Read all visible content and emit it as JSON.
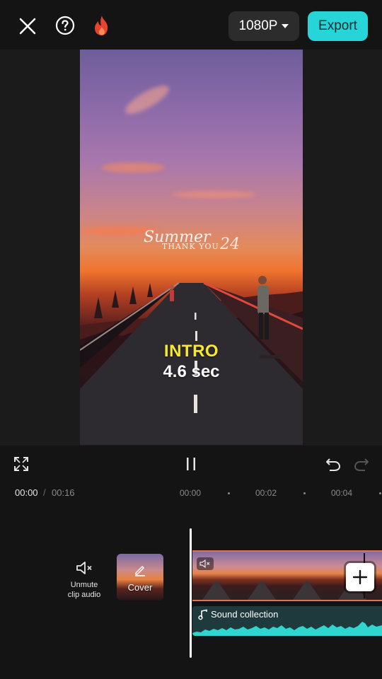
{
  "topbar": {
    "close_icon": "close-icon",
    "help_icon": "help-icon",
    "fire_icon": "fire-icon",
    "resolution_label": "1080P",
    "export_label": "Export",
    "accent_color": "#27d4d8"
  },
  "preview": {
    "watermark_text": "Summer 24 THANK YOU",
    "intro_label": "INTRO",
    "duration_label": "4.6 sec"
  },
  "controls": {
    "fullscreen_icon": "fullscreen-icon",
    "pause_icon": "pause-icon",
    "undo_icon": "undo-icon",
    "redo_icon": "redo-icon"
  },
  "ruler": {
    "current_time": "00:00",
    "separator": "/",
    "total_time": "00:16",
    "ticks": [
      "00:00",
      "00:02",
      "00:04"
    ]
  },
  "timeline": {
    "unmute_label_line1": "Unmute",
    "unmute_label_line2": "clip audio",
    "cover_label": "Cover",
    "audio_track_label": "Sound collection",
    "clip_color": "#e0734b",
    "audio_color": "#2fd6d0"
  }
}
